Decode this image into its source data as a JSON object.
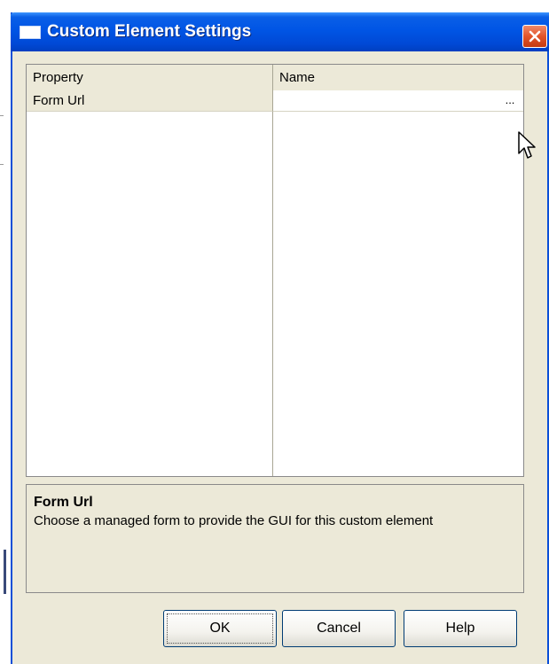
{
  "window": {
    "title": "Custom Element Settings"
  },
  "grid": {
    "columns": [
      "Property",
      "Name"
    ],
    "rows": [
      {
        "property": "Form Url",
        "value": "",
        "ellipsis": "..."
      }
    ]
  },
  "description": {
    "title": "Form Url",
    "text": "Choose a managed form to provide the GUI for this custom element"
  },
  "buttons": {
    "ok": "OK",
    "cancel": "Cancel",
    "help": "Help"
  },
  "icons": {
    "window_icon": "window-icon",
    "close": "close-icon",
    "cursor": "mouse-pointer-icon"
  },
  "colors": {
    "title_bar": "#0055e5",
    "close_button": "#e2542a",
    "dialog_face": "#ece9d8",
    "button_border": "#003c74"
  }
}
